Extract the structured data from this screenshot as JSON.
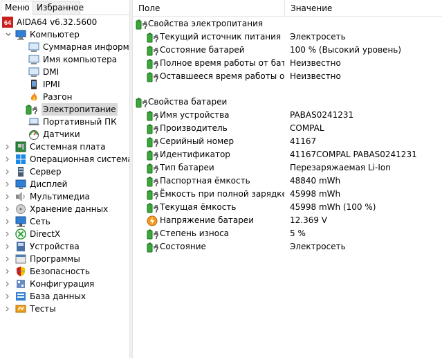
{
  "tabs": {
    "menu": "Меню",
    "favorites": "Избранное"
  },
  "tree": {
    "root": "AIDA64 v6.32.5600",
    "root_badge": "64",
    "computer": "Компьютер",
    "computer_children": [
      {
        "label": "Суммарная информация",
        "icon": "summary-icon"
      },
      {
        "label": "Имя компьютера",
        "icon": "monitor-icon"
      },
      {
        "label": "DMI",
        "icon": "monitor-icon"
      },
      {
        "label": "IPMI",
        "icon": "phone-icon"
      },
      {
        "label": "Разгон",
        "icon": "flame-icon"
      },
      {
        "label": "Электропитание",
        "icon": "battery-plug-icon",
        "selected": true
      },
      {
        "label": "Портативный ПК",
        "icon": "laptop-icon"
      },
      {
        "label": "Датчики",
        "icon": "gauge-icon"
      }
    ],
    "sections": [
      {
        "label": "Системная плата",
        "icon": "motherboard-icon"
      },
      {
        "label": "Операционная система",
        "icon": "windows-icon"
      },
      {
        "label": "Сервер",
        "icon": "server-icon"
      },
      {
        "label": "Дисплей",
        "icon": "display-icon"
      },
      {
        "label": "Мультимедиа",
        "icon": "multimedia-icon"
      },
      {
        "label": "Хранение данных",
        "icon": "storage-icon"
      },
      {
        "label": "Сеть",
        "icon": "network-icon"
      },
      {
        "label": "DirectX",
        "icon": "xbox-icon"
      },
      {
        "label": "Устройства",
        "icon": "devices-icon"
      },
      {
        "label": "Программы",
        "icon": "programs-icon"
      },
      {
        "label": "Безопасность",
        "icon": "shield-icon"
      },
      {
        "label": "Конфигурация",
        "icon": "config-icon"
      },
      {
        "label": "База данных",
        "icon": "database-icon"
      },
      {
        "label": "Тесты",
        "icon": "tests-icon"
      }
    ]
  },
  "table": {
    "col_field": "Поле",
    "col_value": "Значение",
    "group1": "Свойства электропитания",
    "group1_rows": [
      {
        "field": "Текущий источник питания",
        "value": "Электросеть"
      },
      {
        "field": "Состояние батарей",
        "value": "100 % (Высокий уровень)"
      },
      {
        "field": "Полное время работы от бата...",
        "value": "Неизвестно"
      },
      {
        "field": "Оставшееся время работы от ...",
        "value": "Неизвестно"
      }
    ],
    "group2": "Свойства батареи",
    "group2_rows": [
      {
        "field": "Имя устройства",
        "value": "PABAS0241231",
        "icon": "battery-plug-icon"
      },
      {
        "field": "Производитель",
        "value": "COMPAL",
        "icon": "battery-plug-icon"
      },
      {
        "field": "Серийный номер",
        "value": "41167",
        "icon": "battery-plug-icon"
      },
      {
        "field": "Идентификатор",
        "value": "41167COMPAL PABAS0241231",
        "icon": "battery-plug-icon"
      },
      {
        "field": "Тип батареи",
        "value": "Перезаряжаемая Li-Ion",
        "icon": "battery-plug-icon"
      },
      {
        "field": "Паспортная ёмкость",
        "value": "48840 mWh",
        "icon": "battery-plug-icon"
      },
      {
        "field": "Ёмкость при полной зарядке",
        "value": "45998 mWh",
        "icon": "battery-plug-icon"
      },
      {
        "field": "Текущая ёмкость",
        "value": "45998 mWh  (100 %)",
        "icon": "battery-plug-icon"
      },
      {
        "field": "Напряжение батареи",
        "value": "12.369 V",
        "icon": "voltage-icon"
      },
      {
        "field": "Степень износа",
        "value": "5 %",
        "icon": "battery-plug-icon"
      },
      {
        "field": "Состояние",
        "value": "Электросеть",
        "icon": "battery-plug-icon"
      }
    ]
  },
  "colors": {
    "selection": "#d9d9d9",
    "battery_green": "#3aa83a",
    "accent_red": "#c8201e"
  }
}
